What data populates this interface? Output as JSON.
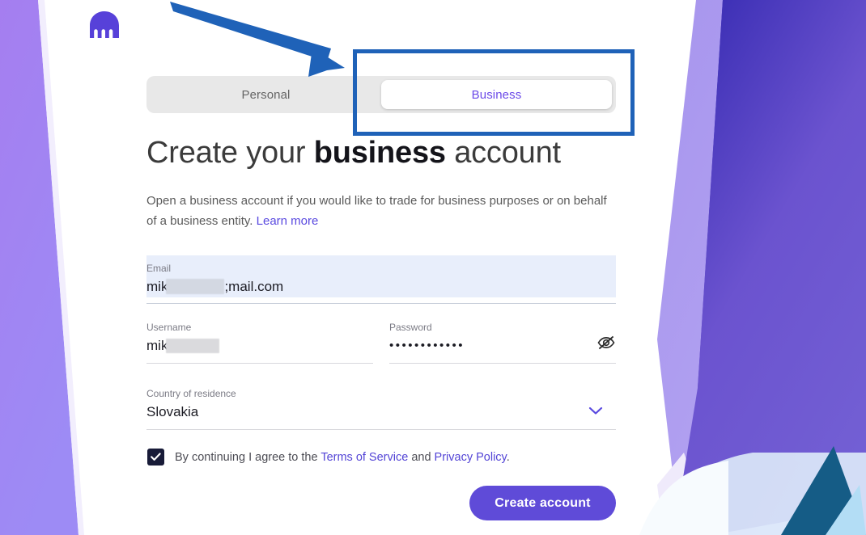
{
  "brand": {
    "logo_icon": "kraken-logo-icon",
    "accent_purple": "#5f4bd8",
    "link_purple": "#5344d6",
    "annotation_blue": "#1f62b8",
    "checkbox_navy": "#181b38",
    "email_field_bg": "#e8eefb",
    "tabbar_bg": "#e8e8e8"
  },
  "tabs": {
    "personal_label": "Personal",
    "business_label": "Business",
    "active": "Business"
  },
  "heading": {
    "part1": "Create your ",
    "emphasis": "business",
    "part2": " account"
  },
  "subtitle": {
    "text": "Open a business account if you would like to trade for business purposes or on behalf of a business entity. ",
    "link_label": "Learn more"
  },
  "form": {
    "email": {
      "label": "Email",
      "value_prefix": "mik",
      "value_suffix": ";mail.com",
      "redacted": true
    },
    "username": {
      "label": "Username",
      "value_prefix": "mik",
      "redacted": true
    },
    "password": {
      "label": "Password",
      "value": "••••••••••••",
      "toggle_icon": "eye-slash-icon"
    },
    "country": {
      "label": "Country of residence",
      "value": "Slovakia",
      "dropdown_icon": "chevron-down-icon"
    }
  },
  "agreement": {
    "checked": true,
    "text_before": "By continuing I agree to the ",
    "terms_label": "Terms of Service",
    "text_between": " and ",
    "privacy_label": "Privacy Policy",
    "text_after": "."
  },
  "cta": {
    "label": "Create account"
  },
  "annotations": {
    "arrow_icon": "annotation-arrow-icon",
    "box_icon": "annotation-highlight-box",
    "target": "Business"
  }
}
